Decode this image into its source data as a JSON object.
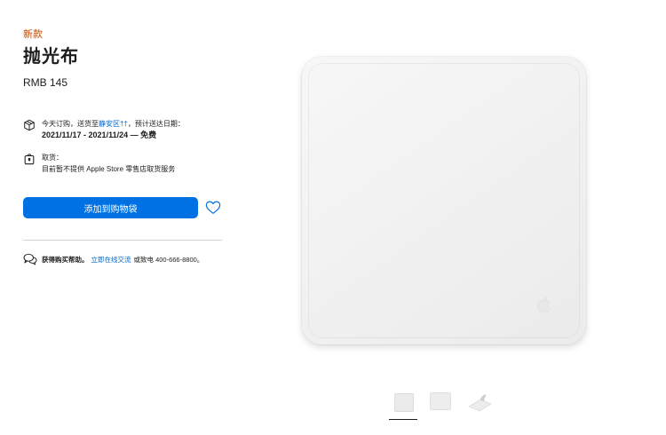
{
  "product": {
    "badge": "新款",
    "title": "抛光布",
    "price": "RMB 145"
  },
  "delivery": {
    "prefix": "今天订购，送货至",
    "location": "静安区",
    "location_suffix": "††",
    "suffix": "，预计送达日期：",
    "dates": "2021/11/17 - 2021/11/24 — 免费"
  },
  "pickup": {
    "label": "取货：",
    "detail": "目前暂不提供 Apple Store 零售店取货服务"
  },
  "actions": {
    "add_to_bag": "添加到购物袋"
  },
  "help": {
    "label": "获得购买帮助。",
    "chat_link": "立即在线交流",
    "phone_text": "或致电 400-666-8800。"
  },
  "colors": {
    "accent": "#0071e3",
    "link": "#0066cc",
    "badge": "#bf4800"
  },
  "gallery": {
    "thumbnails": [
      "thumb-front",
      "thumb-flat",
      "thumb-folded"
    ],
    "selected_index": 0
  }
}
